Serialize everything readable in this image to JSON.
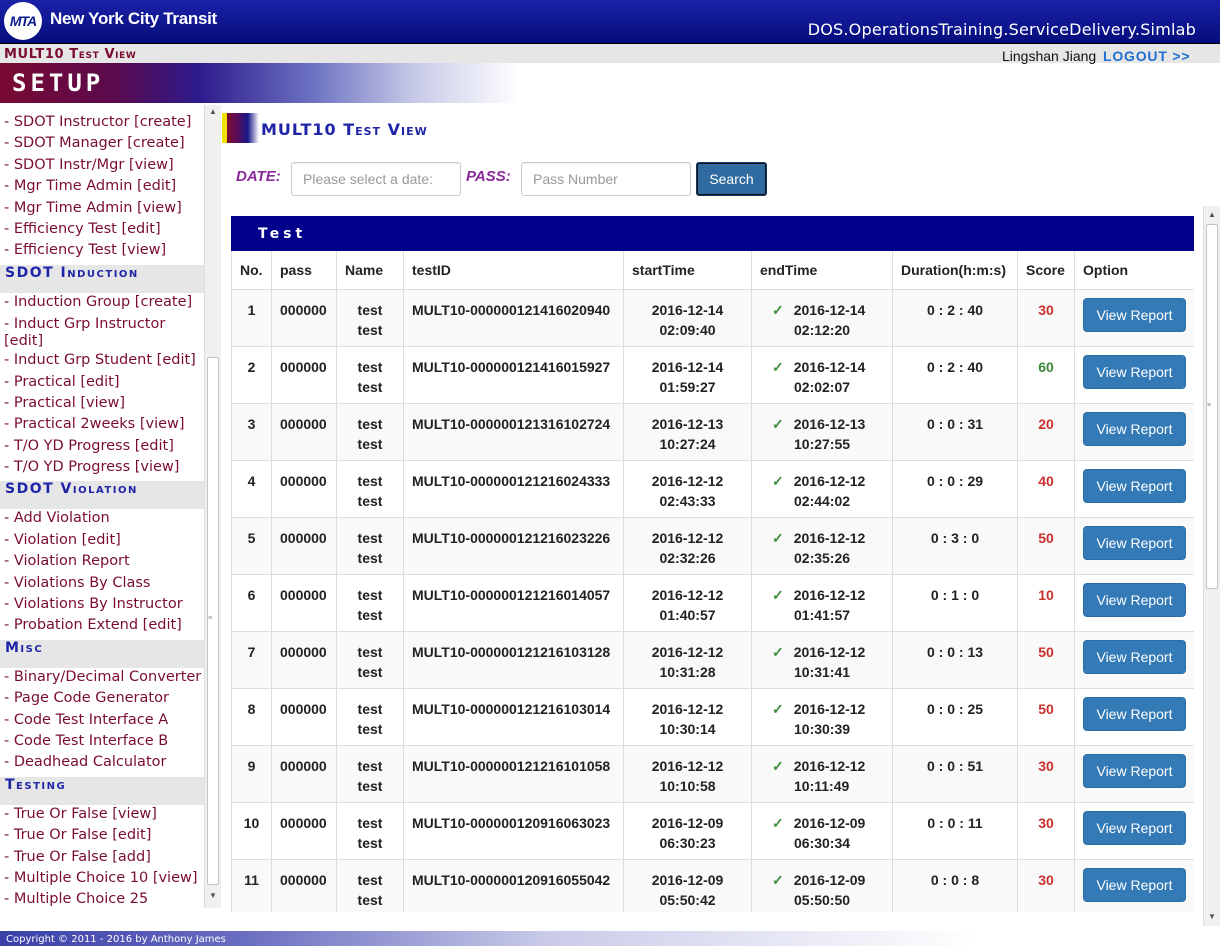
{
  "header": {
    "logo_text": "MTA",
    "org_name": "New York City Transit",
    "system_path": "DOS.OperationsTraining.ServiceDelivery.Simlab"
  },
  "subheader": {
    "page_code": "MULT10 Test View",
    "user_name": "Lingshan Jiang",
    "logout_label": "LOGOUT >>"
  },
  "setup_title": "SETUP",
  "sidebar": {
    "items": [
      {
        "type": "item",
        "label": "- SDOT Instructor [create]"
      },
      {
        "type": "item",
        "label": "- SDOT Manager [create]"
      },
      {
        "type": "item",
        "label": "- SDOT Instr/Mgr [view]"
      },
      {
        "type": "item",
        "label": "- Mgr Time Admin [edit]"
      },
      {
        "type": "item",
        "label": "- Mgr Time Admin [view]"
      },
      {
        "type": "item",
        "label": "- Efficiency Test [edit]"
      },
      {
        "type": "item",
        "label": "- Efficiency Test [view]"
      },
      {
        "type": "head",
        "label": "SDOT Induction"
      },
      {
        "type": "item",
        "label": "- Induction Group [create]"
      },
      {
        "type": "item",
        "label": "- Induct Grp Instructor [edit]",
        "wrap": true
      },
      {
        "type": "item",
        "label": "- Induct Grp Student [edit]"
      },
      {
        "type": "item",
        "label": "- Practical [edit]"
      },
      {
        "type": "item",
        "label": "- Practical [view]"
      },
      {
        "type": "item",
        "label": "- Practical 2weeks [view]"
      },
      {
        "type": "item",
        "label": "- T/O YD Progress [edit]"
      },
      {
        "type": "item",
        "label": "- T/O YD Progress [view]"
      },
      {
        "type": "head",
        "label": "SDOT Violation"
      },
      {
        "type": "item",
        "label": "- Add Violation"
      },
      {
        "type": "item",
        "label": "- Violation [edit]"
      },
      {
        "type": "item",
        "label": "- Violation Report"
      },
      {
        "type": "item",
        "label": "- Violations By Class"
      },
      {
        "type": "item",
        "label": "- Violations By Instructor"
      },
      {
        "type": "item",
        "label": "- Probation Extend [edit]"
      },
      {
        "type": "head",
        "label": "Misc"
      },
      {
        "type": "item",
        "label": "- Binary/Decimal Converter"
      },
      {
        "type": "item",
        "label": "- Page Code Generator"
      },
      {
        "type": "item",
        "label": "- Code Test Interface A"
      },
      {
        "type": "item",
        "label": "- Code Test Interface B"
      },
      {
        "type": "item",
        "label": "- Deadhead Calculator"
      },
      {
        "type": "head",
        "label": "Testing"
      },
      {
        "type": "item",
        "label": "- True Or False [view]"
      },
      {
        "type": "item",
        "label": "- True Or False [edit]"
      },
      {
        "type": "item",
        "label": "- True Or False [add]"
      },
      {
        "type": "item",
        "label": "- Multiple Choice 10 [view]"
      },
      {
        "type": "item",
        "label": "- Multiple Choice 25"
      }
    ]
  },
  "content": {
    "title": "MULT10 Test View",
    "search": {
      "date_label": "DATE:",
      "date_placeholder": "Please select a date:",
      "pass_label": "PASS:",
      "pass_placeholder": "Pass Number",
      "button_label": "Search"
    },
    "panel_title": "Test",
    "columns": [
      "No.",
      "pass",
      "Name",
      "testID",
      "startTime",
      "endTime",
      "Duration(h:m:s)",
      "Score",
      "Option"
    ],
    "rows": [
      {
        "no": "1",
        "pass": "000000",
        "name": "test\ntest",
        "test_id": "MULT10-000000121416020940",
        "start_date": "2016-12-14",
        "start_time": "02:09:40",
        "end_date": "2016-12-14",
        "end_time": "02:12:20",
        "duration": "0 : 2 : 40",
        "score": "30",
        "score_color": "#c9302c",
        "option": "View Report"
      },
      {
        "no": "2",
        "pass": "000000",
        "name": "test\ntest",
        "test_id": "MULT10-000000121416015927",
        "start_date": "2016-12-14",
        "start_time": "01:59:27",
        "end_date": "2016-12-14",
        "end_time": "02:02:07",
        "duration": "0 : 2 : 40",
        "score": "60",
        "score_color": "#3c8a3c",
        "option": "View Report"
      },
      {
        "no": "3",
        "pass": "000000",
        "name": "test\ntest",
        "test_id": "MULT10-000000121316102724",
        "start_date": "2016-12-13",
        "start_time": "10:27:24",
        "end_date": "2016-12-13",
        "end_time": "10:27:55",
        "duration": "0 : 0 : 31",
        "score": "20",
        "score_color": "#c9302c",
        "option": "View Report"
      },
      {
        "no": "4",
        "pass": "000000",
        "name": "test\ntest",
        "test_id": "MULT10-000000121216024333",
        "start_date": "2016-12-12",
        "start_time": "02:43:33",
        "end_date": "2016-12-12",
        "end_time": "02:44:02",
        "duration": "0 : 0 : 29",
        "score": "40",
        "score_color": "#c9302c",
        "option": "View Report"
      },
      {
        "no": "5",
        "pass": "000000",
        "name": "test\ntest",
        "test_id": "MULT10-000000121216023226",
        "start_date": "2016-12-12",
        "start_time": "02:32:26",
        "end_date": "2016-12-12",
        "end_time": "02:35:26",
        "duration": "0 : 3 : 0",
        "score": "50",
        "score_color": "#c9302c",
        "option": "View Report"
      },
      {
        "no": "6",
        "pass": "000000",
        "name": "test\ntest",
        "test_id": "MULT10-000000121216014057",
        "start_date": "2016-12-12",
        "start_time": "01:40:57",
        "end_date": "2016-12-12",
        "end_time": "01:41:57",
        "duration": "0 : 1 : 0",
        "score": "10",
        "score_color": "#c9302c",
        "option": "View Report"
      },
      {
        "no": "7",
        "pass": "000000",
        "name": "test\ntest",
        "test_id": "MULT10-000000121216103128",
        "start_date": "2016-12-12",
        "start_time": "10:31:28",
        "end_date": "2016-12-12",
        "end_time": "10:31:41",
        "duration": "0 : 0 : 13",
        "score": "50",
        "score_color": "#c9302c",
        "option": "View Report"
      },
      {
        "no": "8",
        "pass": "000000",
        "name": "test\ntest",
        "test_id": "MULT10-000000121216103014",
        "start_date": "2016-12-12",
        "start_time": "10:30:14",
        "end_date": "2016-12-12",
        "end_time": "10:30:39",
        "duration": "0 : 0 : 25",
        "score": "50",
        "score_color": "#c9302c",
        "option": "View Report"
      },
      {
        "no": "9",
        "pass": "000000",
        "name": "test\ntest",
        "test_id": "MULT10-000000121216101058",
        "start_date": "2016-12-12",
        "start_time": "10:10:58",
        "end_date": "2016-12-12",
        "end_time": "10:11:49",
        "duration": "0 : 0 : 51",
        "score": "30",
        "score_color": "#c9302c",
        "option": "View Report"
      },
      {
        "no": "10",
        "pass": "000000",
        "name": "test\ntest",
        "test_id": "MULT10-000000120916063023",
        "start_date": "2016-12-09",
        "start_time": "06:30:23",
        "end_date": "2016-12-09",
        "end_time": "06:30:34",
        "duration": "0 : 0 : 11",
        "score": "30",
        "score_color": "#c9302c",
        "option": "View Report"
      },
      {
        "no": "11",
        "pass": "000000",
        "name": "test\ntest",
        "test_id": "MULT10-000000120916055042",
        "start_date": "2016-12-09",
        "start_time": "05:50:42",
        "end_date": "2016-12-09",
        "end_time": "05:50:50",
        "duration": "0 : 0 : 8",
        "score": "30",
        "score_color": "#c9302c",
        "option": "View Report"
      }
    ]
  },
  "footer": {
    "copyright": "Copyright © 2011 - 2016 by Anthony James"
  }
}
